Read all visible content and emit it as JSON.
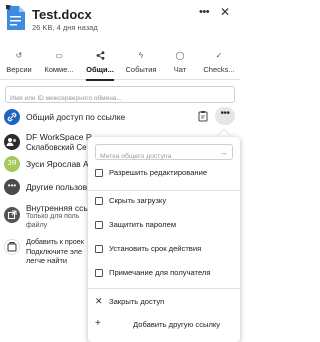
{
  "file": {
    "name": "Test.docx",
    "meta": "26 KB, 4 дня назад",
    "accent_color": "#3f8be0"
  },
  "header": {
    "more_icon": "more-dots-icon",
    "close_icon": "close-icon"
  },
  "tabs": [
    {
      "label": "Версии",
      "icon": "history-icon"
    },
    {
      "label": "Комме...",
      "icon": "comment-icon"
    },
    {
      "label": "Общи...",
      "icon": "share-icon",
      "active": true
    },
    {
      "label": "События",
      "icon": "activity-icon"
    },
    {
      "label": "Чат",
      "icon": "chat-icon"
    },
    {
      "label": "Checks...",
      "icon": "checklist-icon"
    }
  ],
  "search": {
    "placeholder": "Имя или ID межсерверного обмена..."
  },
  "shares": [
    {
      "title": "Общий доступ по ссылке",
      "avatar_color": "#1f64c0"
    },
    {
      "title": "DF WorkSpace R",
      "sub": "Склабовский Се",
      "avatar_color": "#2c2c2c"
    },
    {
      "title": "Зуси Ярослав А",
      "avatar_text": "ЗЯ",
      "avatar_color": "#a7c85a"
    },
    {
      "title": "Другие пользов",
      "avatar_color": "#4a4a4a"
    },
    {
      "title": "Внутренняя ссы",
      "sub1": "Только для поль",
      "sub2": "файлу",
      "avatar_color": "#555555"
    },
    {
      "title": "Добавить к проек",
      "sub1": "Подключите эле",
      "sub2": "легче найти",
      "avatar_color": "#ffffff"
    }
  ],
  "menu": {
    "label_placeholder": "Метка общего доступа",
    "items": [
      {
        "label": "Разрешить редактирование",
        "checked": false
      },
      {
        "label": "Скрыть загрузку",
        "checked": false
      },
      {
        "label": "Защитить паролем",
        "checked": false
      },
      {
        "label": "Установить срок действия",
        "checked": false
      },
      {
        "label": "Примечание для получателя",
        "checked": false
      }
    ],
    "close_label": "Закрыть доступ",
    "add_label": "Добавить другую ссылку"
  }
}
